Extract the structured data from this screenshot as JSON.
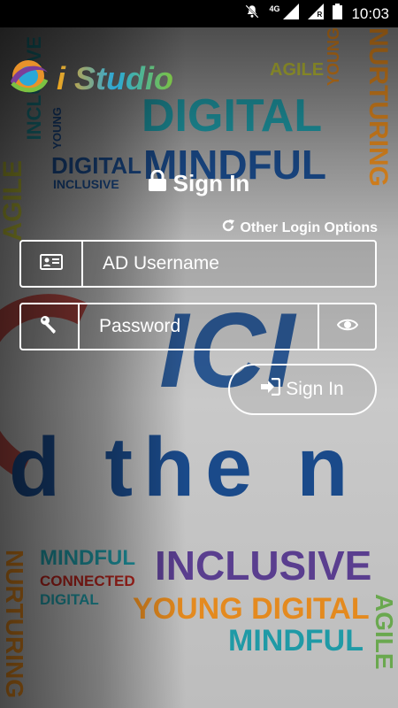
{
  "status_bar": {
    "time": "10:03",
    "network": "4G",
    "roaming": "R"
  },
  "app": {
    "name": "i Studio"
  },
  "login": {
    "title": "Sign In",
    "other_options": "Other Login Options",
    "username_placeholder": "AD Username",
    "password_placeholder": "Password",
    "submit_label": "Sign In"
  },
  "background": {
    "words": [
      "AGILE",
      "YOUNG",
      "NURTURING",
      "DIGITAL",
      "MINDFUL",
      "INCLUSIVE",
      "YOUNG",
      "DIGITAL",
      "INCLUSIVE",
      "AGILE",
      "NURTURING",
      "ICI",
      "d the n",
      "MINDFUL",
      "CONNECTED",
      "DIGITAL",
      "INCLUSIVE",
      "YOUNG DIGITAL",
      "MINDFUL",
      "AGILE",
      "NURTURING"
    ],
    "colors": {
      "teal": "#1f9aa6",
      "blue": "#1a4a8a",
      "orange": "#e48a1f",
      "purple": "#5a3e8f",
      "green": "#6aa84f",
      "yellow": "#c6c93a",
      "red": "#b3231c"
    }
  },
  "colors": {
    "foreground": "#ffffff",
    "status_bar": "#000000"
  },
  "icons": [
    "mute-icon",
    "signal-icon",
    "roaming-signal-icon",
    "battery-icon",
    "app-logo-icon",
    "lock-icon",
    "refresh-icon",
    "id-card-icon",
    "key-icon",
    "eye-icon",
    "sign-in-icon"
  ]
}
